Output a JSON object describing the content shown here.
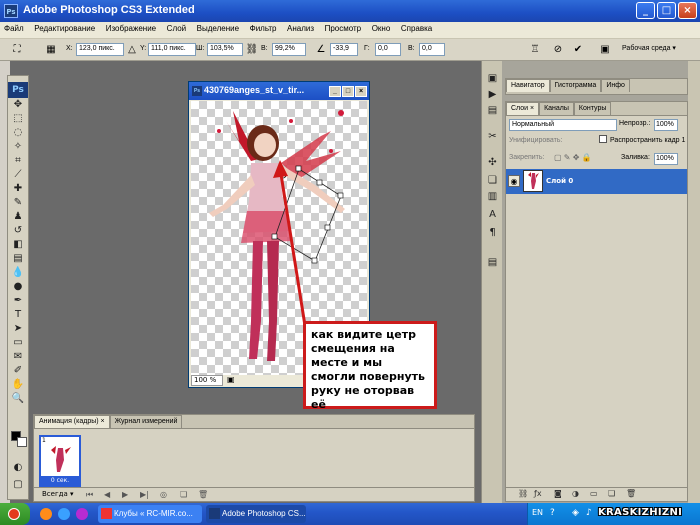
{
  "window": {
    "title": "Adobe Photoshop CS3 Extended"
  },
  "menu": [
    "Файл",
    "Редактирование",
    "Изображение",
    "Слой",
    "Выделение",
    "Фильтр",
    "Анализ",
    "Просмотр",
    "Окно",
    "Справка"
  ],
  "options": {
    "x_label": "X:",
    "x_value": "123,0 пикс.",
    "y_label": "Y:",
    "y_value": "111,0 пикс.",
    "w_label": "Ш:",
    "w_value": "103,5%",
    "h_label": "В:",
    "h_value": "99,2%",
    "angle_value": "-33,9",
    "g_label": "Г:",
    "g_value": "0,0",
    "v_label": "В:",
    "v_value": "0,0",
    "workspace": "Рабочая среда ▾"
  },
  "document": {
    "title": "430769anges_st_v_tir...",
    "zoom": "100 %"
  },
  "callout": "как видите цетр смещения на месте и мы смогли повернуть руку не оторвав её",
  "animation": {
    "tab_frames": "Анимация (кадры) ×",
    "tab_log": "Журнал измерений",
    "frame_number": "1",
    "frame_delay": "0 сек.",
    "loop": "Всегда ▾"
  },
  "panels": {
    "tab_navigator": "Навигатор",
    "tab_histogram": "Гистограмма",
    "tab_info": "Инфо",
    "tab_layers": "Слои ×",
    "tab_channels": "Каналы",
    "tab_paths": "Контуры",
    "blend_mode": "Нормальный",
    "opacity_label": "Непрозр.:",
    "opacity_value": "100%",
    "unify_label": "Унифицировать:",
    "propagate_label": "Распространить кадр 1",
    "lock_label": "Закрепить:",
    "fill_label": "Заливка:",
    "fill_value": "100%",
    "layer_name": "Слой 0"
  },
  "taskbar": {
    "task1": "Клубы « RC-MIR.co...",
    "task2": "Adobe Photoshop CS...",
    "lang": "EN"
  },
  "watermark": "KRASKIZHIZNI",
  "colors": {
    "accent": "#316ac5",
    "callout_border": "#cc1b1b",
    "arrow": "#d01818"
  }
}
